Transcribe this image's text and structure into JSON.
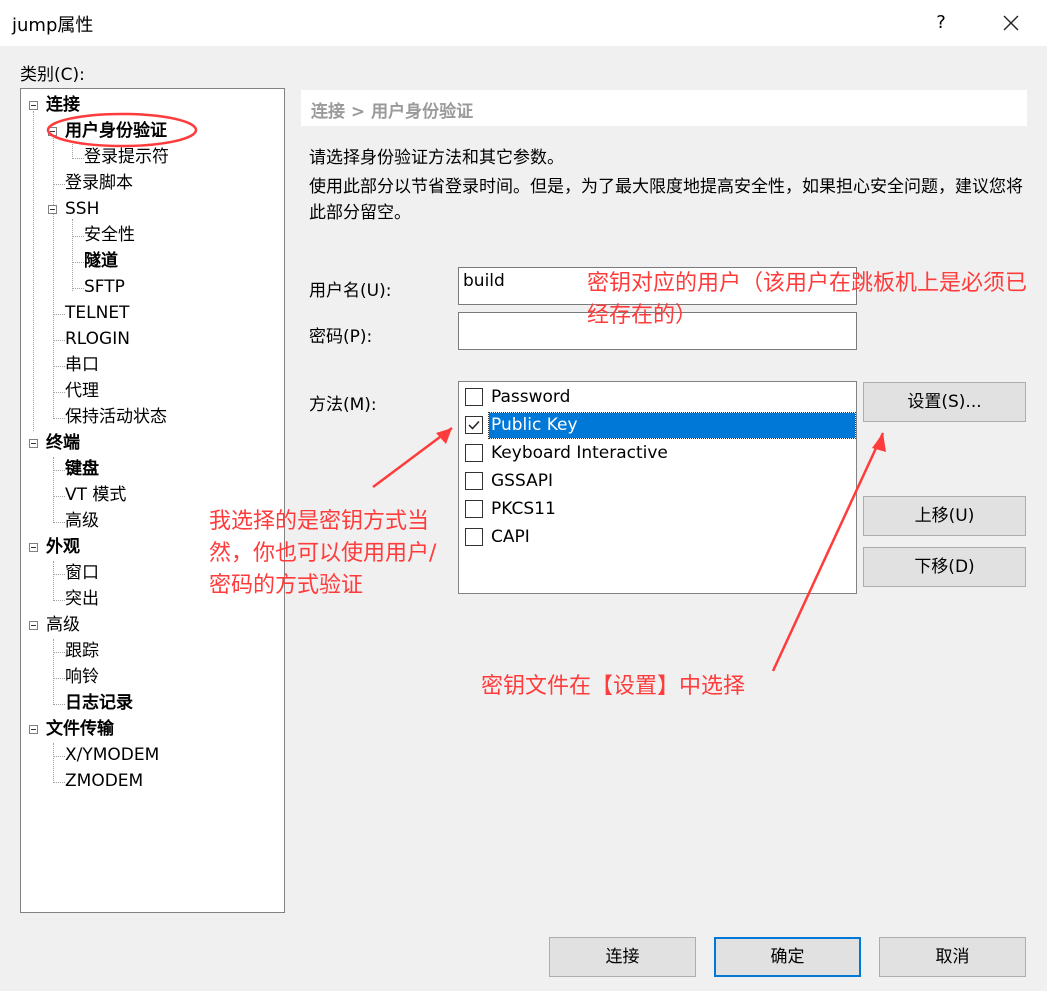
{
  "window": {
    "title": "jump属性",
    "help": "?"
  },
  "category_label": "类别(C):",
  "tree": {
    "connection": "连接",
    "user_auth": "用户身份验证",
    "login_prompt": "登录提示符",
    "login_script": "登录脚本",
    "ssh": "SSH",
    "security": "安全性",
    "tunnel": "隧道",
    "sftp": "SFTP",
    "telnet": "TELNET",
    "rlogin": "RLOGIN",
    "serial": "串口",
    "proxy": "代理",
    "keepalive": "保持活动状态",
    "terminal": "终端",
    "keyboard": "键盘",
    "vt_mode": "VT 模式",
    "advanced_t": "高级",
    "appearance": "外观",
    "window": "窗口",
    "highlight": "突出",
    "advanced": "高级",
    "trace": "跟踪",
    "bell": "响铃",
    "logging": "日志记录",
    "file_transfer": "文件传输",
    "xymodem": "X/YMODEM",
    "zmodem": "ZMODEM"
  },
  "panel": {
    "breadcrumb": "连接 > 用户身份验证",
    "desc1": "请选择身份验证方法和其它参数。",
    "desc2": "使用此部分以节省登录时间。但是，为了最大限度地提高安全性，如果担心安全问题，建议您将此部分留空。",
    "username_label": "用户名(U):",
    "username_value": "build",
    "password_label": "密码(P):",
    "password_value": "",
    "method_label": "方法(M):",
    "methods": [
      {
        "label": "Password",
        "checked": false
      },
      {
        "label": "Public Key",
        "checked": true
      },
      {
        "label": "Keyboard Interactive",
        "checked": false
      },
      {
        "label": "GSSAPI",
        "checked": false
      },
      {
        "label": "PKCS11",
        "checked": false
      },
      {
        "label": "CAPI",
        "checked": false
      }
    ],
    "settings_button": "设置(S)...",
    "move_up_button": "上移(U)",
    "move_down_button": "下移(D)"
  },
  "footer": {
    "connect": "连接",
    "ok": "确定",
    "cancel": "取消"
  },
  "annotations": {
    "user_note": "密钥对应的用户（该用户在跳板机上是必须已经存在的）",
    "method_note": "我选择的是密钥方式当然，你也可以使用用户/密码的方式验证",
    "settings_note": "密钥文件在【设置】中选择",
    "color": "#ff3b3b"
  }
}
